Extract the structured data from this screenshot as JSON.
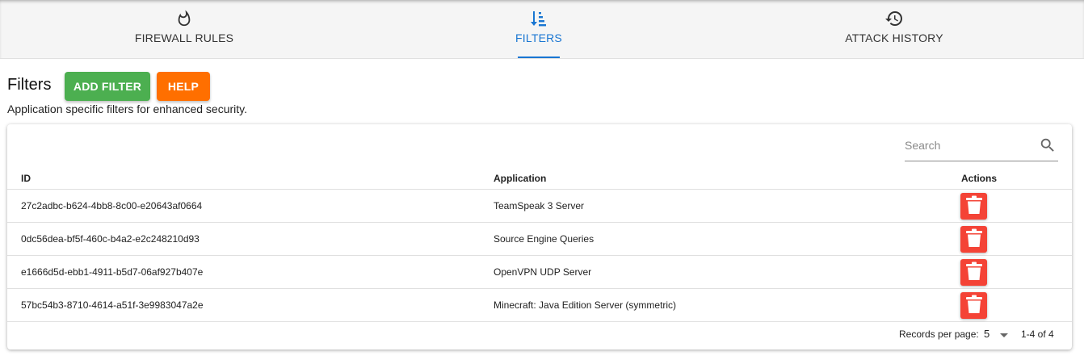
{
  "tabs": [
    {
      "label": "FIREWALL RULES",
      "icon": "flame-icon",
      "active": false
    },
    {
      "label": "FILTERS",
      "icon": "sort-descending-icon",
      "active": true
    },
    {
      "label": "ATTACK HISTORY",
      "icon": "history-icon",
      "active": false
    }
  ],
  "colors": {
    "accent": "#1976d2",
    "add_button": "#4caf50",
    "help_button": "#ff6f00",
    "delete_button": "#f44336"
  },
  "header": {
    "title": "Filters",
    "add_label": "ADD FILTER",
    "help_label": "HELP",
    "subtitle": "Application specific filters for enhanced security."
  },
  "table": {
    "search_placeholder": "Search",
    "columns": {
      "id": "ID",
      "application": "Application",
      "actions": "Actions"
    },
    "rows": [
      {
        "id": "27c2adbc-b624-4bb8-8c00-e20643af0664",
        "application": "TeamSpeak 3 Server",
        "action_icon": "trash-icon"
      },
      {
        "id": "0dc56dea-bf5f-460c-b4a2-e2c248210d93",
        "application": "Source Engine Queries",
        "action_icon": "trash-icon"
      },
      {
        "id": "e1666d5d-ebb1-4911-b5d7-06af927b407e",
        "application": "OpenVPN UDP Server",
        "action_icon": "trash-icon"
      },
      {
        "id": "57bc54b3-8710-4614-a51f-3e9983047a2e",
        "application": "Minecraft: Java Edition Server (symmetric)",
        "action_icon": "trash-icon"
      }
    ],
    "footer": {
      "records_per_page_label": "Records per page:",
      "records_per_page_value": "5",
      "page_info": "1-4 of 4"
    }
  }
}
